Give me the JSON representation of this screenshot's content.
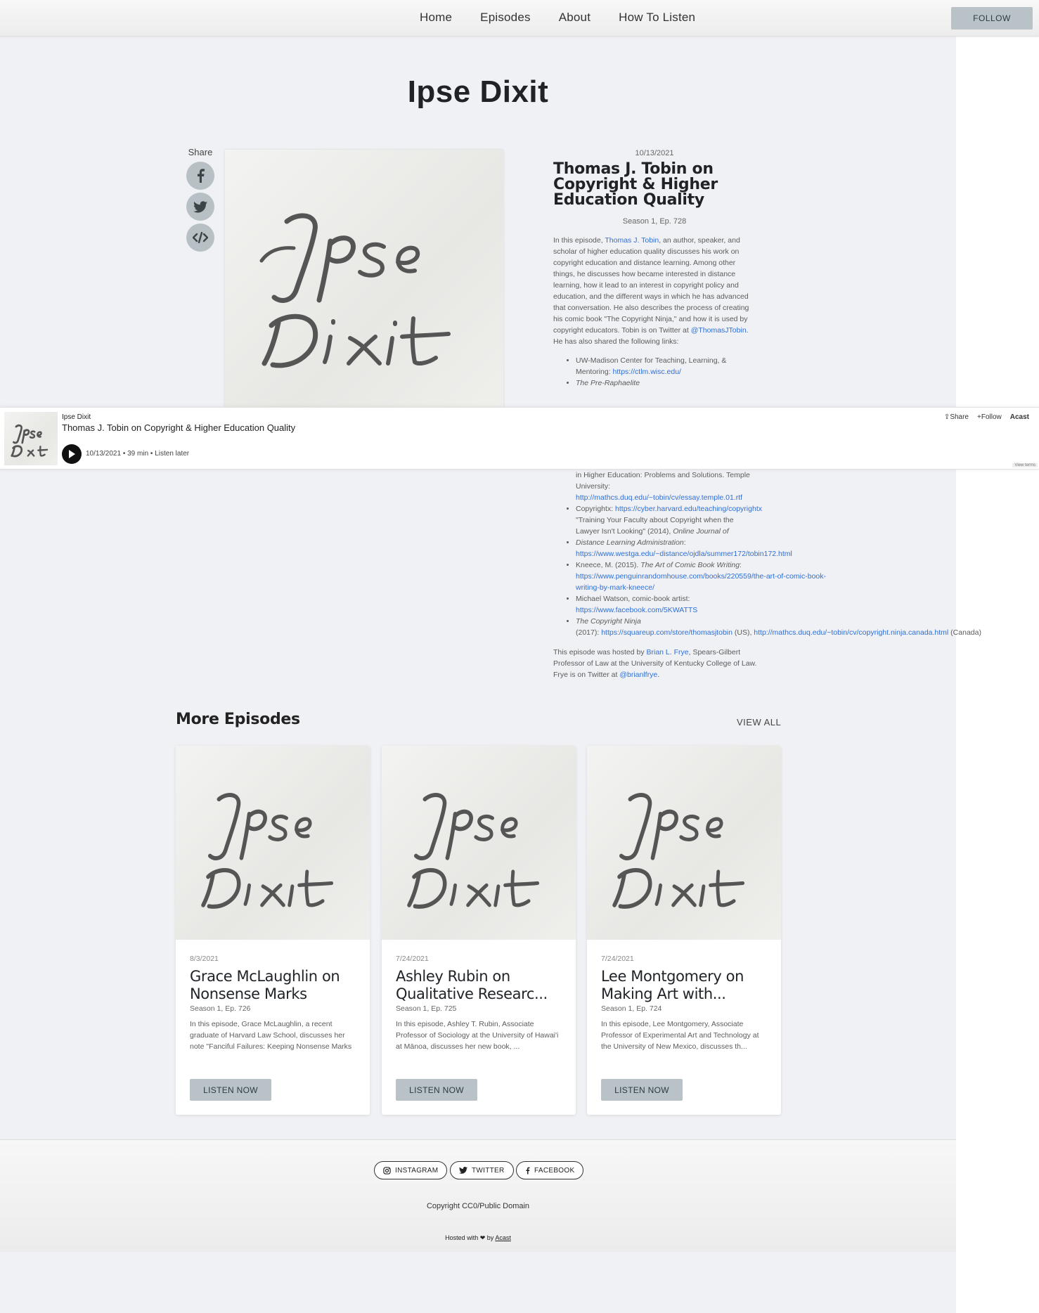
{
  "nav": {
    "links": [
      "Home",
      "Episodes",
      "About",
      "How To Listen"
    ],
    "follow_label": "FOLLOW"
  },
  "site_title": "Ipse Dixit",
  "share": {
    "label": "Share",
    "icons": [
      "facebook-icon",
      "twitter-icon",
      "embed-code-icon"
    ]
  },
  "episode": {
    "date": "10/13/2021",
    "title": "Thomas J. Tobin on Copyright & Higher Education Quality",
    "season": "Season 1, Ep. 728",
    "desc_1": "In this episode, ",
    "desc_link1": "Thomas J. Tobin",
    "desc_2": ", an author, speaker, and scholar of higher education quality discusses his work on copyright education and distance learning. Among other things, he discusses how became interested in distance learning, how it lead to an interest in copyright policy and education, and the different ways in which he has advanced that conversation. He also describes the process of creating his comic book \"The Copyright Ninja,\" and how it is used by copyright educators. Tobin is on Twitter at ",
    "desc_link2": "@ThomasJTobin",
    "desc_3": ". He has also shared the following links:",
    "link1_text": "UW-Madison Center for Teaching, Learning, & Mentoring: ",
    "link1_url": "https://ctlm.wisc.edu/",
    "link2_text": "The Pre-Raphaelite",
    "lower": {
      "cont_text": "in Higher Education: Problems and Solutions. Temple University: ",
      "cont_url": "http://mathcs.duq.edu/~tobin/cv/essay.temple.01.rtf",
      "copyrightx_text": "Copyrightx: ",
      "copyrightx_url": "https://cyber.harvard.edu/teaching/copyrightx",
      "training_text": "\"Training Your Faculty about Copyright when the Lawyer Isn't Looking\" (2014), ",
      "training_ital": "Online Journal of Distance Learning Administration",
      "training_colon": ": ",
      "training_url": "https://www.westga.edu/~distance/ojdla/summer172/tobin172.html",
      "kneece_text": "Kneece, M. (2015). ",
      "kneece_ital": "The Art of Comic Book Writing",
      "kneece_colon": ": ",
      "kneece_url": "https://www.penguinrandomhouse.com/books/220559/the-art-of-comic-book-writing-by-mark-kneece/",
      "watson_text": "Michael Watson, comic-book artist: ",
      "watson_url": "https://www.facebook.com/5KWATTS",
      "ninja_ital": "The Copyright Ninja",
      "ninja_text": " (2017): ",
      "ninja_url1": "https://squareup.com/store/thomasjtobin",
      "ninja_us": " (US), ",
      "ninja_url2": "http://mathcs.duq.edu/~tobin/cv/copyright.ninja.canada.html",
      "ninja_ca": " (Canada)"
    },
    "hosted_1": "This episode was hosted by ",
    "hosted_link": "Brian L. Frye",
    "hosted_2": ", Spears-Gilbert Professor of Law at the University of Kentucky College of Law. Frye is on Twitter at ",
    "hosted_twitter": "@brianlfrye",
    "hosted_3": "."
  },
  "player": {
    "podcast": "Ipse Dixit",
    "title": "Thomas J. Tobin on Copyright & Higher Education Quality",
    "date": "10/13/2021",
    "duration": "39 min",
    "listen_later": "Listen later",
    "share": "Share",
    "follow": "Follow",
    "brand": "Acast",
    "terms": "View terms"
  },
  "more": {
    "heading": "More Episodes",
    "view_all": "VIEW ALL",
    "cards": [
      {
        "date": "8/3/2021",
        "title": "Grace McLaughlin on Nonsense Marks",
        "season": "Season 1, Ep. 726",
        "desc": "In this episode, Grace McLaughlin, a recent graduate of Harvard Law School, discusses her note \"Fanciful Failures: Keeping Nonsense Marks on the Trademark Register\"...",
        "button": "LISTEN NOW"
      },
      {
        "date": "7/24/2021",
        "title": "Ashley Rubin on Qualitative Researc...",
        "season": "Season 1, Ep. 725",
        "desc": "In this episode, Ashley T. Rubin, Associate Professor of Sociology at the University of Hawai'i at Mānoa, discusses her new book, ...",
        "button": "LISTEN NOW"
      },
      {
        "date": "7/24/2021",
        "title": "Lee Montgomery on Making Art with...",
        "season": "Season 1, Ep. 724",
        "desc": "In this episode, Lee Montgomery, Associate Professor of Experimental Art and Technology at the University of New Mexico, discusses th...",
        "button": "LISTEN NOW"
      }
    ]
  },
  "footer": {
    "instagram": "INSTAGRAM",
    "twitter": "TWITTER",
    "facebook": "FACEBOOK",
    "copyright": "Copyright CC0/Public Domain",
    "hosted_prefix": "Hosted with",
    "hosted_by": "by",
    "hosted_link": "Acast"
  }
}
